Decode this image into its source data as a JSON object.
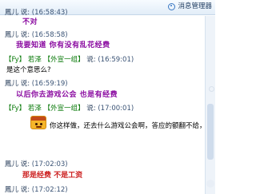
{
  "toolbar": {
    "manager_button": {
      "icon": "message-manager-icon",
      "label": "消息管理器"
    }
  },
  "messages": [
    {
      "sender": "鳳儿",
      "said": "说:",
      "time": "(16:58:43)",
      "text": "不对",
      "style": "purple-bold"
    },
    {
      "sender": "鳳儿",
      "said": "说:",
      "time": "(16:58:58)",
      "text": "我要知道  你有没有乱花经费",
      "style": "purple-bold"
    },
    {
      "tag": "【Fy】",
      "sender": "若泽",
      "group": "【外宣一组】",
      "said": "说:",
      "time": "(16:59:01)",
      "text": "是这个意思么?",
      "style": "black"
    },
    {
      "sender": "鳳儿",
      "said": "说:",
      "time": "(16:59:19)",
      "text": "以后你去游戏公会  也是有经费",
      "style": "purple-bold"
    },
    {
      "tag": "【Fy】",
      "sender": "若泽",
      "group": "【外宣一组】",
      "said": "说:",
      "time": "(17:00:01)",
      "text": "你这样做，还去什么游戏公会啊，答应的额翻不给，",
      "style": "black",
      "emoji": "cartoon-face-icon"
    },
    {
      "sender": "鳳儿",
      "said": "说:",
      "time": "(17:02:03)",
      "text": "那是经费  不是工资",
      "style": "red-bold"
    },
    {
      "sender": "鳳儿",
      "said": "说:",
      "time": "(17:02:12)"
    }
  ]
}
